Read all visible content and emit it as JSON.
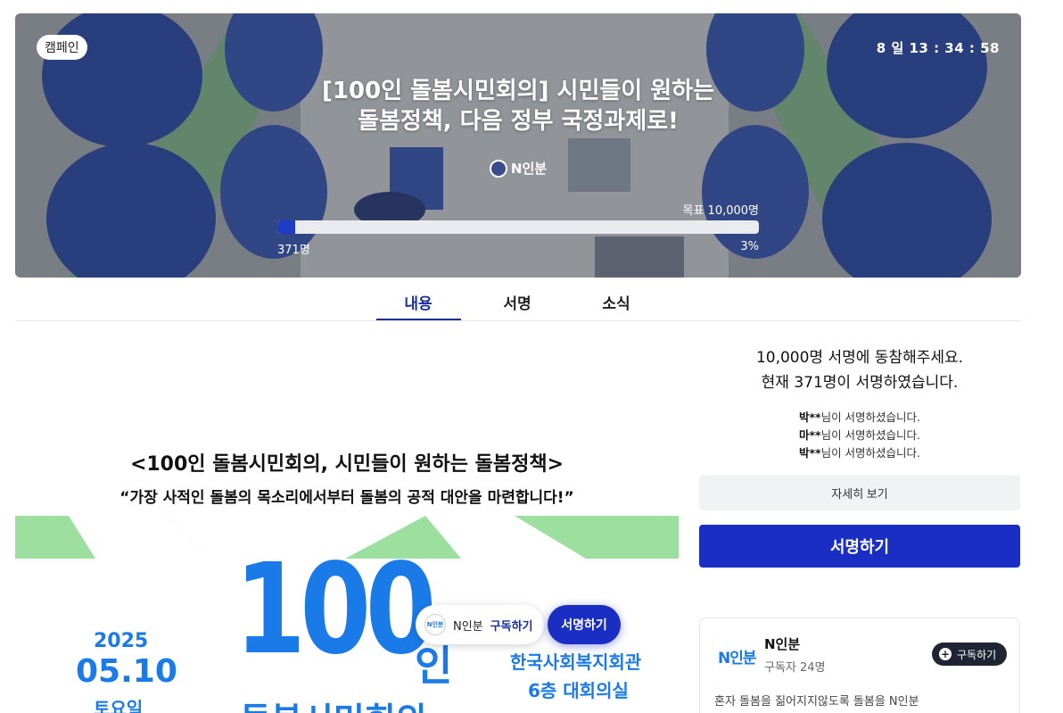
{
  "hero": {
    "tag": "캠페인",
    "timer": "8 일 13 : 34 : 58",
    "title_line1": "[100인 돌봄시민회의] 시민들이 원하는",
    "title_line2": "돌봄정책, 다음 정부 국정과제로!",
    "organizer": "N인분",
    "goal_label": "목표 10,000명",
    "current_count": "371명",
    "progress_percent_label": "3%",
    "progress_fraction": 0.0371
  },
  "tabs": [
    {
      "label": "내용",
      "active": true
    },
    {
      "label": "서명",
      "active": false
    },
    {
      "label": "소식",
      "active": false
    }
  ],
  "content": {
    "heading": "<100인 돌봄시민회의, 시민들이 원하는 돌봄정책>",
    "quote": "“가장 사적인 돌봄의 목소리에서부터 돌봄의 공적 대안을 마련합니다!”",
    "poster": {
      "year": "2025",
      "month_day": "05.10",
      "weekday": "토요일",
      "big_number": "100",
      "big_suffix": "인",
      "big_sub": "돌봄시민회의",
      "venue_line1": "한국사회복지회관",
      "venue_line2": "6층 대회의실"
    }
  },
  "floating": {
    "logo_text": "N인분",
    "name": "N인분",
    "subscribe": "구독하기",
    "sign": "서명하기"
  },
  "sidebar": {
    "line1": "10,000명 서명에 동참해주세요.",
    "line2": "현재 371명이 서명하였습니다.",
    "signers": [
      {
        "name": "박**",
        "suffix": "님이 서명하셨습니다."
      },
      {
        "name": "마**",
        "suffix": "님이 서명하셨습니다."
      },
      {
        "name": "박**",
        "suffix": "님이 서명하셨습니다."
      }
    ],
    "detail_button": "자세히 보기",
    "sign_button": "서명하기"
  },
  "org_card": {
    "logo_text": "N인분",
    "name": "N인분",
    "subscribers": "구독자 24명",
    "follow_button": "구독하기",
    "description": "혼자 돌봄을 짊어지지않도록 돌봄을 N인분"
  },
  "colors": {
    "primary": "#1a2ec4",
    "accent_blue": "#1a7ae8",
    "poster_green": "#9ddf9f"
  }
}
